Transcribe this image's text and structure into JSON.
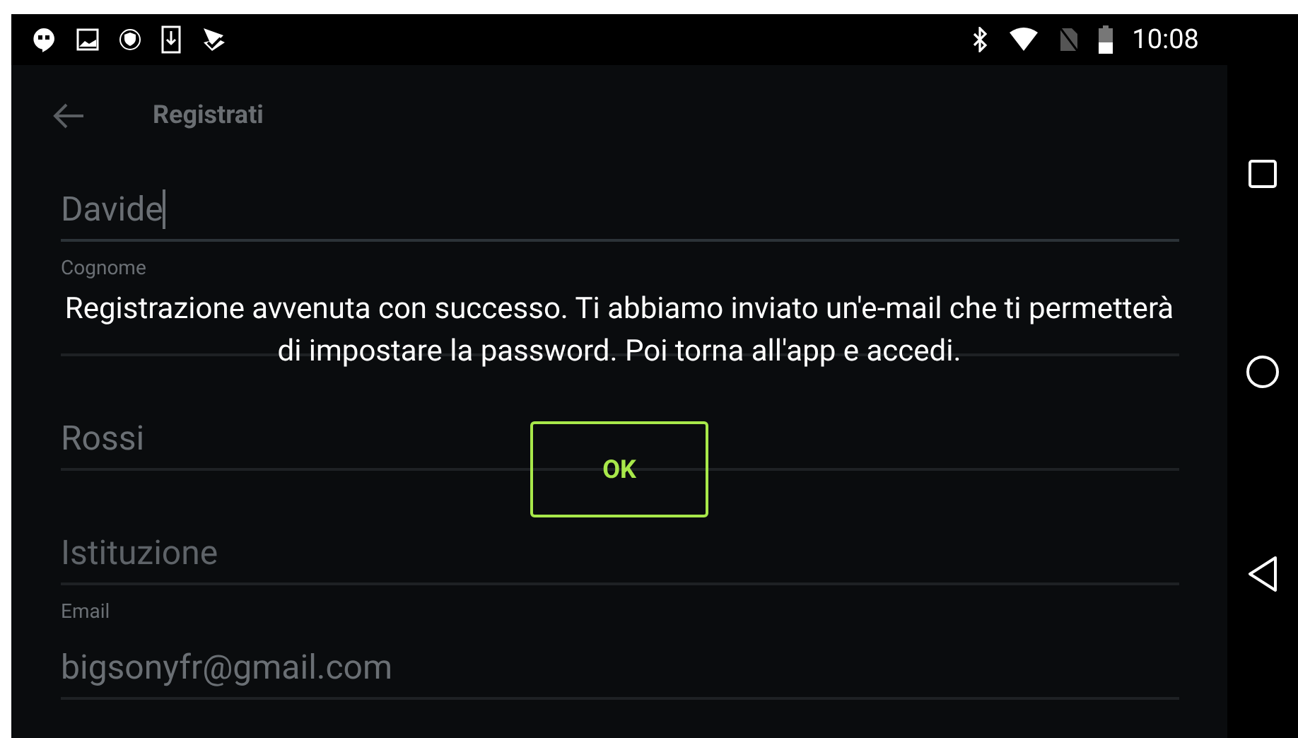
{
  "status_bar": {
    "time": "10:08"
  },
  "toolbar": {
    "title": "Registrati"
  },
  "form": {
    "fields": [
      {
        "value": "Davide",
        "focused": true
      },
      {
        "label": "Cognome",
        "focused": false
      },
      {
        "value": "Rossi",
        "focused": false
      },
      {
        "placeholder": "Istituzione",
        "focused": false
      },
      {
        "label": "Email",
        "value": "bigsonyfr@gmail.com",
        "focused": false
      }
    ]
  },
  "dialog": {
    "message": "Registrazione avvenuta con successo. Ti abbiamo inviato un'e-mail che ti permetterà di impostare la password. Poi torna all'app e accedi.",
    "buttons": [
      {
        "label": "OK"
      }
    ]
  }
}
